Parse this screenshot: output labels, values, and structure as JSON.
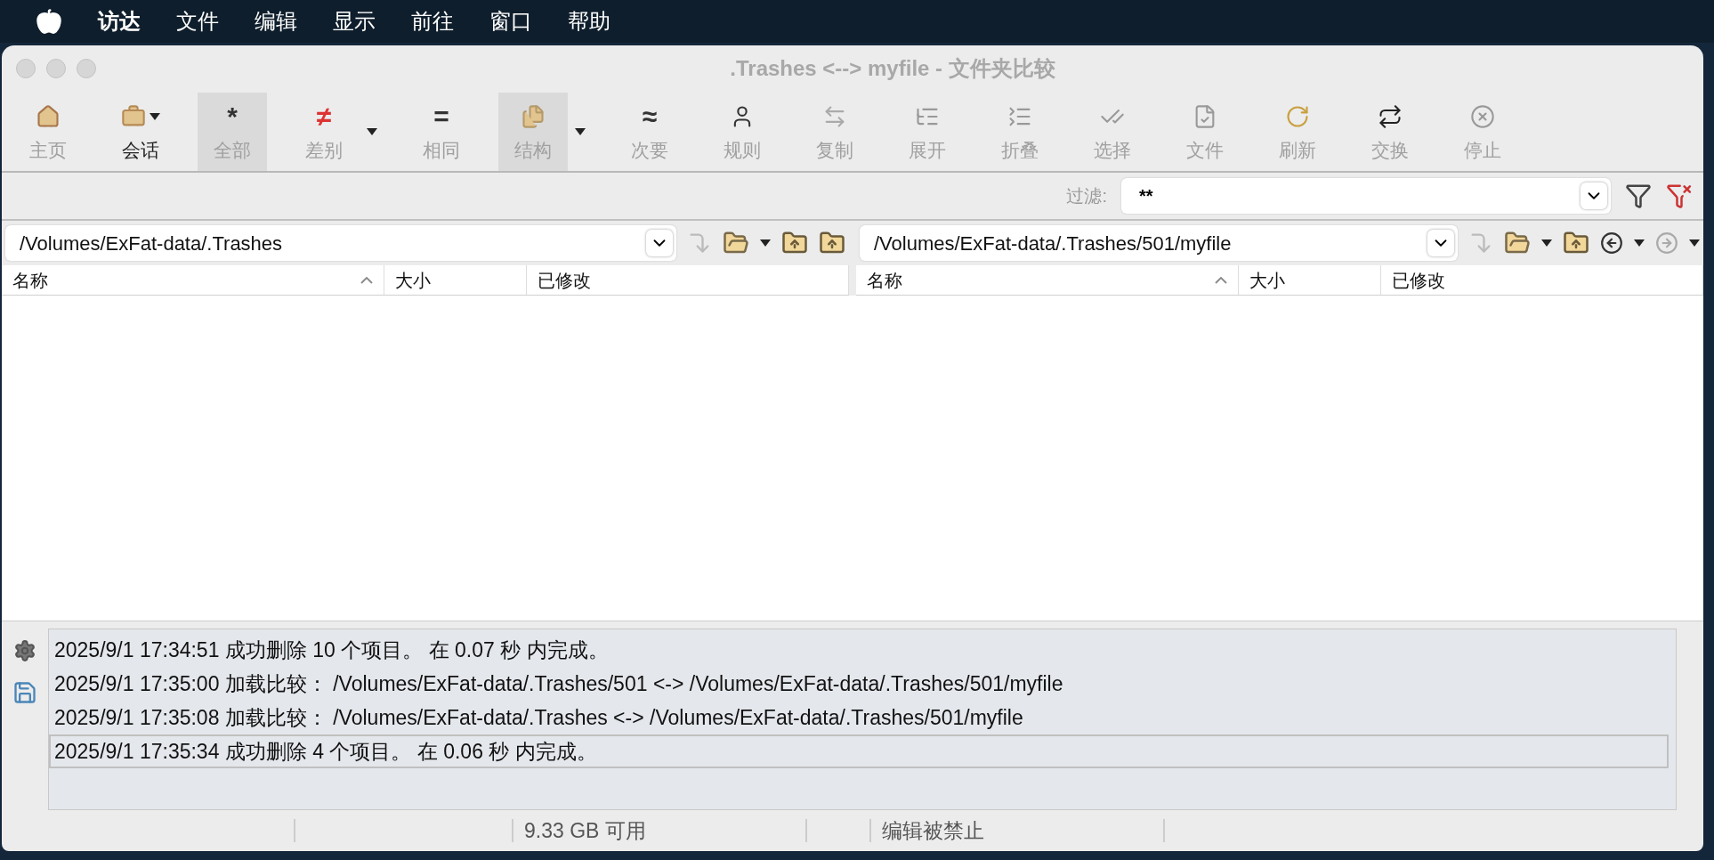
{
  "menu_bar": {
    "items": [
      {
        "label": "访达",
        "bold": true
      },
      {
        "label": "文件",
        "bold": false
      },
      {
        "label": "编辑",
        "bold": false
      },
      {
        "label": "显示",
        "bold": false
      },
      {
        "label": "前往",
        "bold": false
      },
      {
        "label": "窗口",
        "bold": false
      },
      {
        "label": "帮助",
        "bold": false
      }
    ]
  },
  "window": {
    "title": ".Trashes <--> myfile - 文件夹比较"
  },
  "toolbar": [
    {
      "label": "主页",
      "disabled": true,
      "selected": false,
      "menu_arrow": false
    },
    {
      "label": "会话",
      "disabled": false,
      "selected": false,
      "menu_arrow": true
    },
    {
      "label": "全部",
      "glyph": "*",
      "disabled": true,
      "selected": true,
      "menu_arrow": false
    },
    {
      "label": "差别",
      "glyph": "≠",
      "disabled": true,
      "selected": false,
      "menu_arrow": true
    },
    {
      "label": "相同",
      "glyph": "=",
      "disabled": true,
      "selected": false,
      "menu_arrow": false
    },
    {
      "label": "结构",
      "disabled": true,
      "selected": true,
      "menu_arrow": true
    },
    {
      "label": "次要",
      "glyph": "≈",
      "disabled": true,
      "selected": false,
      "menu_arrow": false
    },
    {
      "label": "规则",
      "disabled": true,
      "selected": false,
      "menu_arrow": false
    },
    {
      "label": "复制",
      "disabled": true,
      "selected": false,
      "menu_arrow": false
    },
    {
      "label": "展开",
      "disabled": true,
      "selected": false,
      "menu_arrow": false
    },
    {
      "label": "折叠",
      "disabled": true,
      "selected": false,
      "menu_arrow": false
    },
    {
      "label": "选择",
      "disabled": true,
      "selected": false,
      "menu_arrow": false
    },
    {
      "label": "文件",
      "disabled": true,
      "selected": false,
      "menu_arrow": false
    },
    {
      "label": "刷新",
      "disabled": true,
      "selected": false,
      "menu_arrow": false
    },
    {
      "label": "交换",
      "disabled": true,
      "selected": false,
      "menu_arrow": false
    },
    {
      "label": "停止",
      "disabled": true,
      "selected": false,
      "menu_arrow": false
    }
  ],
  "filter": {
    "label": "过滤:",
    "value": "**"
  },
  "panes": [
    {
      "path": "/Volumes/ExFat-data/.Trashes",
      "columns": [
        "名称",
        "大小",
        "已修改"
      ],
      "history": false
    },
    {
      "path": "/Volumes/ExFat-data/.Trashes/501/myfile",
      "columns": [
        "名称",
        "大小",
        "已修改"
      ],
      "history": true
    }
  ],
  "log": [
    {
      "text": "2025/9/1 17:34:51  成功删除 10 个项目。  在 0.07 秒 内完成。",
      "selected": false
    },
    {
      "text": "2025/9/1 17:35:00  加载比较：  /Volumes/ExFat-data/.Trashes/501 <-> /Volumes/ExFat-data/.Trashes/501/myfile",
      "selected": false
    },
    {
      "text": "2025/9/1 17:35:08  加载比较：  /Volumes/ExFat-data/.Trashes <-> /Volumes/ExFat-data/.Trashes/501/myfile",
      "selected": false
    },
    {
      "text": "2025/9/1 17:35:34  成功删除 4 个项目。  在 0.06 秒 内完成。",
      "selected": true
    }
  ],
  "status_bar": {
    "free_space": "9.33 GB 可用",
    "edit_state": "编辑被禁止"
  }
}
